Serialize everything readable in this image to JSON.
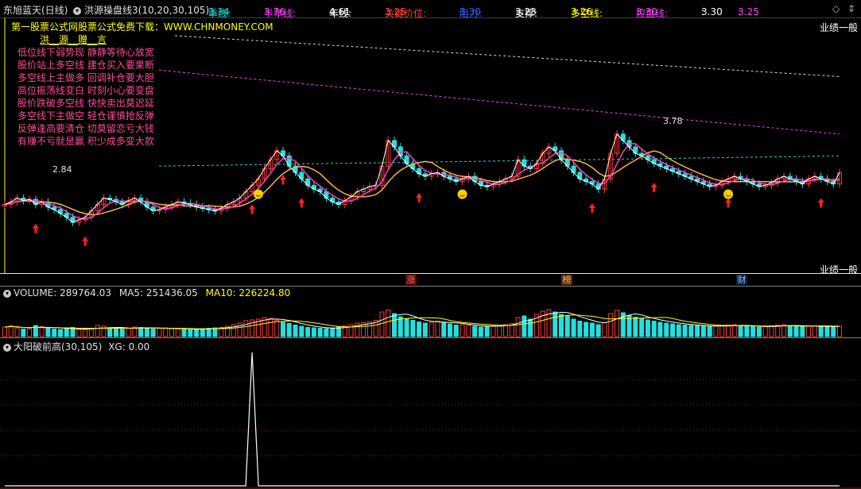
{
  "header": {
    "stock": "东旭蓝天(日线)",
    "indicator": "洪源操盘线3(10,20,30,105)",
    "items": [
      {
        "key": "季线",
        "sep": ": ",
        "val": "3.34",
        "keyColor": "#19d7d7",
        "valColor": "#19d7d7"
      },
      {
        "key": "半年线",
        "sep": ": ",
        "val": "3.76",
        "keyColor": "#ff40ff",
        "valColor": "#ff40ff"
      },
      {
        "key": "年线",
        "sep": ": ",
        "val": "4.61",
        "keyColor": "#ffffff",
        "valColor": "#ffffff"
      },
      {
        "key": "关键价位",
        "sep": ": ",
        "val": "3.25",
        "keyColor": "#ff4040",
        "valColor": "#ff4040"
      },
      {
        "key": "阻力",
        "sep": ": ",
        "val": "3.30",
        "keyColor": "#3060ff",
        "valColor": "#3060ff"
      },
      {
        "key": "支撑",
        "sep": ": ",
        "val": "3.23",
        "keyColor": "#ffffff",
        "valColor": "#ffffff"
      },
      {
        "key": "多空线",
        "sep": ": ",
        "val": "3.26",
        "keyColor": "#ffff00",
        "valColor": "#ffff00"
      },
      {
        "key": "控盘线",
        "sep": ": ",
        "val": "3.30",
        "keyColor": "#ff40ff",
        "valColor": "#ff40ff"
      },
      {
        "key": "",
        "sep": ": ",
        "val": "3.30",
        "keyColor": "#ffffff",
        "valColor": "#ffffff"
      },
      {
        "key": "",
        "sep": ": ",
        "val": "3.25",
        "keyColor": "#ff40ff",
        "valColor": "#ff40ff"
      }
    ],
    "icons": [
      "◇",
      "⇕"
    ]
  },
  "legend": {
    "download": "第一股票公式网股票公式免费下载：WWW.CHNMONEY.COM",
    "title": "洪__源__赠__言",
    "lines": [
      "低位线下弱势现  静静等待心放宽",
      "股价站上多空线  建仓买入要果断",
      "多空线上主做多  回调补仓要大胆",
      "高位振荡线变白  时刻小心要变盘",
      "股价跌破多空线  快快卖出莫迟延",
      "多空线下主做空  轻仓谨慎抢反弹",
      "反弹逢高要清仓  切莫留恋亏大钱",
      "有赚不亏就是赢  积少成多变大款"
    ]
  },
  "price_panel": {
    "industry_label": "业绩一般",
    "industry_label_bottom": "业绩一般",
    "low_label": "2.84",
    "high_label": "3.78",
    "badges": [
      {
        "text": "涨",
        "color": "#ff3030"
      },
      {
        "text": "榜",
        "color": "#ff9040"
      },
      {
        "text": "财",
        "color": "#60a0ff"
      }
    ]
  },
  "volume_panel": {
    "title_key": "VOLUME",
    "title_val": "289764.03",
    "ma5_key": "MA5",
    "ma5_val": "251436.05",
    "ma10_key": "MA10",
    "ma10_val": "226224.80"
  },
  "xg_panel": {
    "title": "大阳破前高(30,105)",
    "xg_key": "XG",
    "xg_val": "0.00"
  },
  "chart_data": {
    "type": "line",
    "close": [
      3.0,
      3.02,
      3.05,
      3.03,
      3.04,
      3.0,
      3.02,
      2.98,
      2.96,
      2.93,
      2.9,
      2.86,
      2.88,
      2.9,
      2.95,
      3.0,
      3.05,
      3.04,
      3.02,
      3.0,
      3.03,
      3.05,
      3.02,
      2.98,
      2.95,
      2.96,
      2.98,
      3.0,
      3.02,
      3.01,
      3.0,
      2.98,
      2.97,
      2.96,
      2.95,
      2.97,
      3.0,
      3.02,
      3.05,
      3.1,
      3.15,
      3.2,
      3.28,
      3.35,
      3.42,
      3.38,
      3.3,
      3.25,
      3.2,
      3.15,
      3.12,
      3.1,
      3.05,
      3.02,
      3.0,
      3.03,
      3.06,
      3.1,
      3.12,
      3.14,
      3.15,
      3.3,
      3.5,
      3.45,
      3.38,
      3.32,
      3.28,
      3.24,
      3.22,
      3.24,
      3.25,
      3.22,
      3.2,
      3.18,
      3.2,
      3.22,
      3.18,
      3.15,
      3.14,
      3.16,
      3.18,
      3.2,
      3.22,
      3.35,
      3.3,
      3.28,
      3.32,
      3.4,
      3.45,
      3.42,
      3.35,
      3.3,
      3.25,
      3.2,
      3.18,
      3.16,
      3.12,
      3.2,
      3.4,
      3.55,
      3.5,
      3.45,
      3.4,
      3.38,
      3.35,
      3.32,
      3.3,
      3.28,
      3.26,
      3.24,
      3.22,
      3.2,
      3.18,
      3.16,
      3.14,
      3.15,
      3.18,
      3.2,
      3.22,
      3.2,
      3.18,
      3.16,
      3.14,
      3.15,
      3.17,
      3.2,
      3.22,
      3.2,
      3.18,
      3.16,
      3.2,
      3.22,
      3.2,
      3.18,
      3.16,
      3.25
    ],
    "volume": [
      120,
      135,
      110,
      95,
      100,
      140,
      125,
      105,
      95,
      90,
      100,
      115,
      90,
      85,
      95,
      140,
      130,
      110,
      100,
      95,
      105,
      120,
      115,
      100,
      95,
      105,
      110,
      100,
      95,
      90,
      85,
      95,
      100,
      105,
      110,
      115,
      130,
      150,
      170,
      200,
      210,
      220,
      240,
      230,
      205,
      180,
      165,
      145,
      130,
      115,
      110,
      105,
      100,
      105,
      120,
      135,
      150,
      170,
      175,
      185,
      205,
      310,
      335,
      290,
      250,
      225,
      205,
      185,
      170,
      180,
      195,
      180,
      160,
      145,
      150,
      140,
      130,
      120,
      125,
      135,
      145,
      155,
      165,
      240,
      260,
      220,
      280,
      320,
      340,
      310,
      280,
      260,
      220,
      195,
      180,
      170,
      150,
      175,
      290,
      330,
      300,
      265,
      245,
      225,
      210,
      195,
      180,
      170,
      160,
      150,
      145,
      140,
      135,
      130,
      125,
      130,
      140,
      145,
      150,
      140,
      130,
      125,
      120,
      125,
      135,
      145,
      150,
      140,
      130,
      125,
      130,
      135,
      130,
      125,
      120,
      130
    ],
    "xg_signal_index": 40,
    "low": 2.84,
    "high": 3.78
  }
}
